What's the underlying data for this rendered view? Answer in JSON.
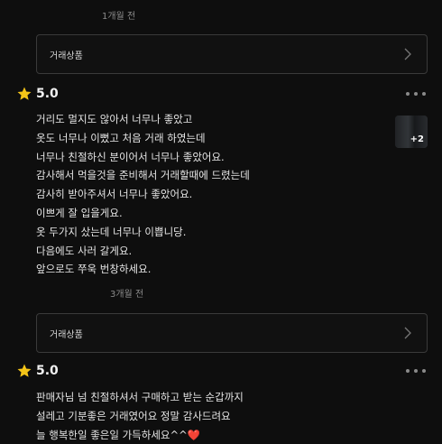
{
  "reviews": [
    {
      "time_above": "1개월 전",
      "product_label": "거래상품",
      "rating": "5.0",
      "photo_count": "+2",
      "lines": [
        "거리도 멀지도 않아서 너무나 좋았고",
        "옷도 너무나 이뻤고 처음 거래 하였는데",
        "너무나 친절하신 분이어서 너무나 좋았어요.",
        "감사해서 먹을것을 준비해서 거래할때에 드렸는데",
        "감사히 받아주셔서 너무나 좋았어요.",
        "이쁘게 잘 입을게요.",
        "옷 두가지 샀는데 너무나 이쁩니당.",
        "다음에도 사러 갈게요.",
        "앞으로도 쭈욱 번창하세요."
      ]
    },
    {
      "time_above": "3개월 전",
      "product_label": "거래상품",
      "rating": "5.0",
      "lines": [
        "판매자님 넘 친절하셔서 구매하고 받는 순갑까지",
        "설레고 기분좋은 거래였어요 정말 감사드려요",
        "늘 행복한일 좋은일 가득하세요^^❤️"
      ]
    }
  ],
  "icons": {
    "star": "star-icon",
    "chevron": "chevron-right-icon",
    "more": "more-options-icon"
  },
  "colors": {
    "star": "#f5c518",
    "heart": "#e0303a"
  }
}
